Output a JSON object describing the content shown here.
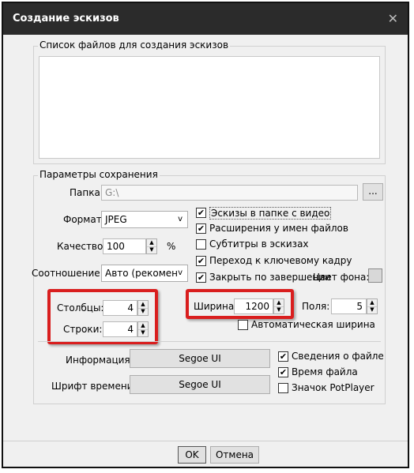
{
  "window": {
    "title": "Создание эскизов"
  },
  "file_list": {
    "legend": "Список файлов для создания эскизов"
  },
  "save": {
    "legend": "Параметры сохранения",
    "folder_label": "Папка:",
    "folder_value": "G:\\",
    "browse_label": "...",
    "format_label": "Формат:",
    "format_value": "JPEG",
    "quality_label": "Качество:",
    "quality_value": "100",
    "quality_unit": "%",
    "ratio_label": "Соотношение:",
    "ratio_value": "Авто (рекомен",
    "options": [
      {
        "label": "Эскизы в папке с видео",
        "checked": true
      },
      {
        "label": "Расширения у имен файлов",
        "checked": true
      },
      {
        "label": "Субтитры в эскизах",
        "checked": false
      },
      {
        "label": "Переход к ключевому кадру",
        "checked": true
      },
      {
        "label": "Закрыть по завершении",
        "checked": true
      }
    ],
    "bg_color_label": "Цвет фона:",
    "bg_color": "#d8d8d8"
  },
  "grid": {
    "columns_label": "Столбцы:",
    "columns_value": "4",
    "rows_label": "Строки:",
    "rows_value": "4",
    "width_label": "Ширина:",
    "width_value": "1200",
    "margin_label": "Поля:",
    "margin_value": "5",
    "auto_width_label": "Автоматическая ширина",
    "auto_width_checked": false
  },
  "fonts": {
    "info_label": "Информация:",
    "info_font": "Segoe UI",
    "time_label": "Шрифт времени:",
    "time_font": "Segoe UI",
    "options": [
      {
        "label": "Сведения о файле",
        "checked": true
      },
      {
        "label": "Время файла",
        "checked": true
      },
      {
        "label": "Значок PotPlayer",
        "checked": false
      }
    ]
  },
  "footer": {
    "ok_label": "OK",
    "cancel_label": "Отмена"
  },
  "colors": {
    "highlight": "#d91e1e",
    "titlebar": "#2b2b2b"
  }
}
